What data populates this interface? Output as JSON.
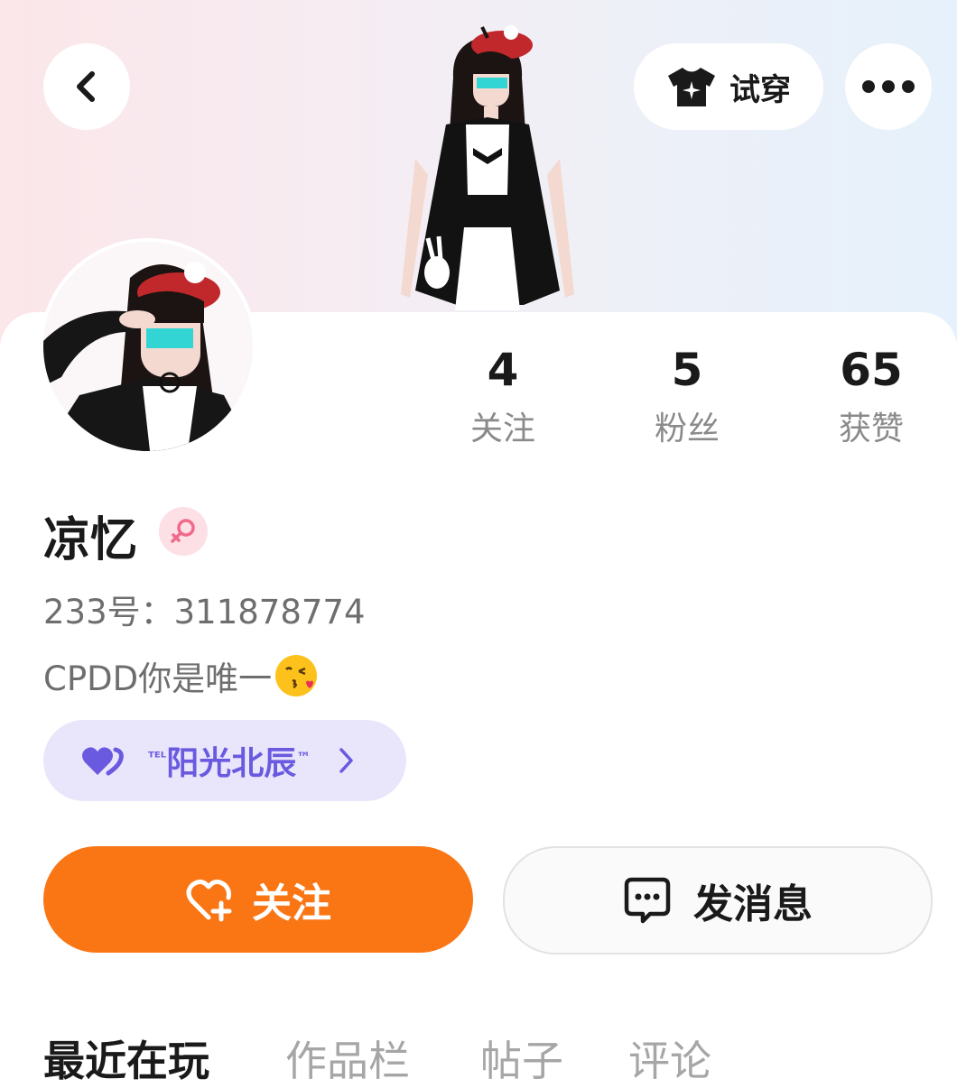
{
  "header": {
    "back_icon": "chevron-left-icon",
    "try_on_label": "试穿",
    "try_on_icon": "tshirt-icon",
    "more_icon": "more-dots-icon"
  },
  "stats": [
    {
      "value": "4",
      "label": "关注"
    },
    {
      "value": "5",
      "label": "粉丝"
    },
    {
      "value": "65",
      "label": "获赞"
    }
  ],
  "profile": {
    "name": "凉忆",
    "gender_icon": "female-symbol-icon",
    "uid": "233号：311878774",
    "bio": "CPDD你是唯一",
    "bio_emoji": "face-blowing-kiss-emoji"
  },
  "cp_badge": {
    "prefix": "ᵀᴱᴸ",
    "name": "阳光北辰",
    "suffix": "™",
    "icon": "double-heart-icon"
  },
  "actions": {
    "follow_label": "关注",
    "message_label": "发消息"
  },
  "tabs": [
    "最近在玩",
    "作品栏",
    "帖子",
    "评论"
  ],
  "colors": {
    "accent_orange": "#fa7615",
    "cp_purple": "#6a5ae0",
    "cp_bg": "#e9e6fb"
  }
}
